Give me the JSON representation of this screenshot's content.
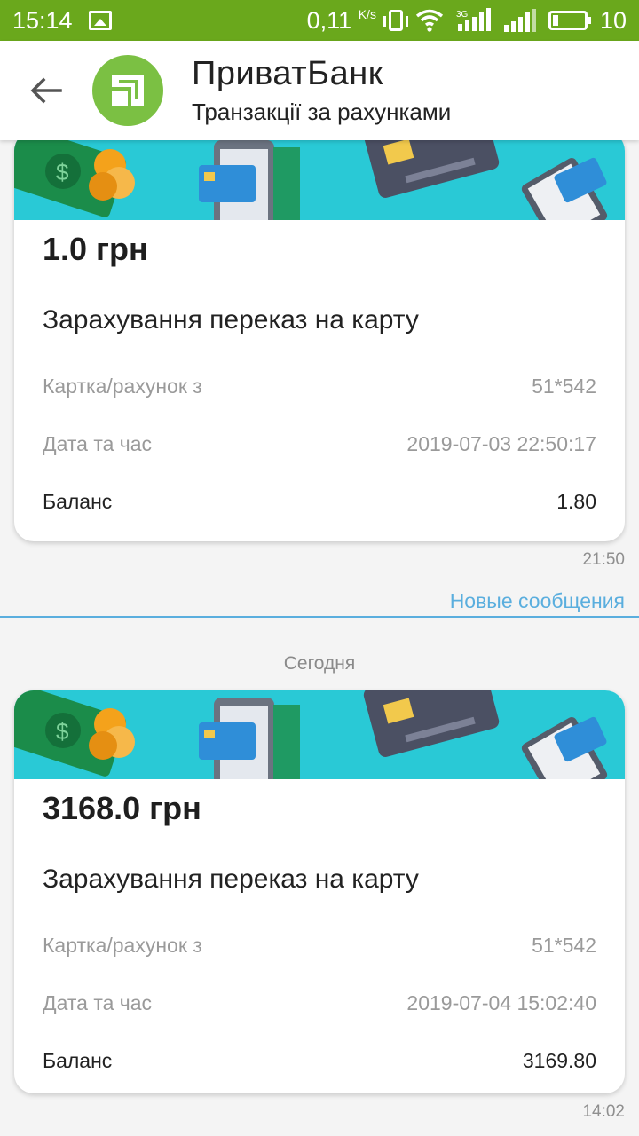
{
  "status_bar": {
    "time": "15:14",
    "speed": "0,11",
    "speed_unit": "K/s",
    "battery": "10",
    "network_label": "3G",
    "icons": [
      "gallery-icon",
      "vibrate-icon",
      "wifi-icon",
      "signal-3g-icon",
      "signal-icon",
      "battery-icon"
    ]
  },
  "header": {
    "title": "ПриватБанк",
    "subtitle": "Транзакції за рахунками",
    "back_icon": "back-arrow-icon",
    "logo_icon": "privatbank-logo-icon",
    "accent": "#7bc043"
  },
  "messages": [
    {
      "amount": "1.0 грн",
      "description": "Зарахування переказ на карту",
      "rows": [
        {
          "label": "Картка/рахунок з",
          "value": "51*542"
        },
        {
          "label": "Дата та час",
          "value": "2019-07-03 22:50:17"
        },
        {
          "label": "Баланс",
          "value": "1.80"
        }
      ],
      "time": "21:50"
    },
    {
      "amount": "3168.0 грн",
      "description": "Зарахування переказ на карту",
      "rows": [
        {
          "label": "Картка/рахунок з",
          "value": "51*542"
        },
        {
          "label": "Дата та час",
          "value": "2019-07-04 15:02:40"
        },
        {
          "label": "Баланс",
          "value": "3169.80"
        }
      ],
      "time": "14:02"
    }
  ],
  "new_messages_label": "Новые сообщения",
  "day_label": "Сегодня",
  "colors": {
    "status_bar": "#6aa81c",
    "banner": "#29c9d6",
    "link": "#5aaede"
  }
}
